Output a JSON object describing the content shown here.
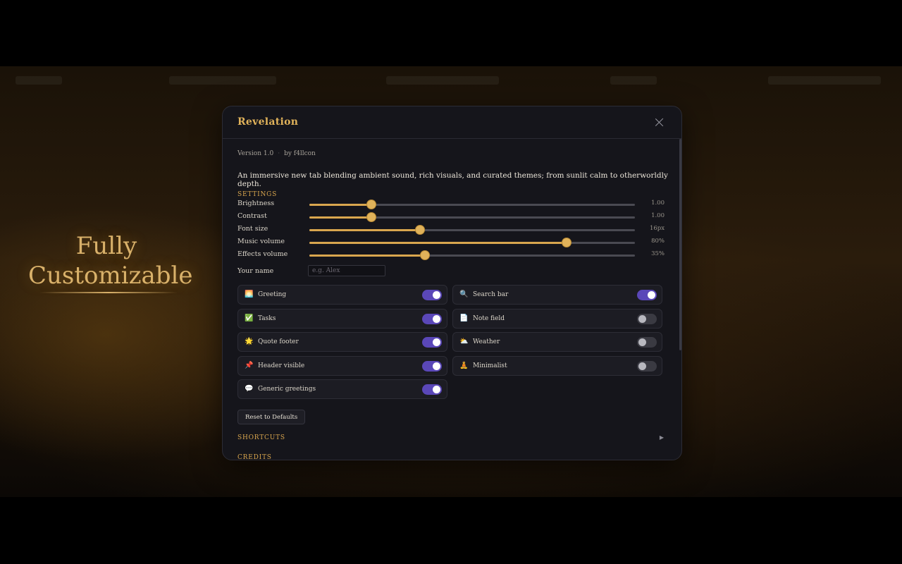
{
  "hero": {
    "line1": "Fully",
    "line2": "Customizable"
  },
  "modal": {
    "title": "Revelation",
    "version": "Version 1.0",
    "author": "by f4llcon",
    "description": "An immersive new tab blending ambient sound, rich visuals, and curated themes; from sunlit calm to otherworldly depth."
  },
  "settings": {
    "label": "SETTINGS",
    "sliders": [
      {
        "label": "Brightness",
        "value_text": "1.00",
        "fraction": 0.19
      },
      {
        "label": "Contrast",
        "value_text": "1.00",
        "fraction": 0.19
      },
      {
        "label": "Font size",
        "value_text": "16px",
        "fraction": 0.34
      },
      {
        "label": "Music volume",
        "value_text": "80%",
        "fraction": 0.79
      },
      {
        "label": "Effects volume",
        "value_text": "35%",
        "fraction": 0.355
      }
    ],
    "name_label": "Your name",
    "name_placeholder": "e.g. Alex",
    "name_value": ""
  },
  "toggles": [
    {
      "label": "Greeting",
      "icon": "🌅",
      "icon_name": "sunrise-icon",
      "on": true
    },
    {
      "label": "Search bar",
      "icon": "🔍",
      "icon_name": "search-icon",
      "on": true
    },
    {
      "label": "Tasks",
      "icon": "✅",
      "icon_name": "checkbox-icon",
      "on": true
    },
    {
      "label": "Note field",
      "icon": "📄",
      "icon_name": "note-icon",
      "on": false
    },
    {
      "label": "Quote footer",
      "icon": "🌟",
      "icon_name": "star-icon",
      "on": true
    },
    {
      "label": "Weather",
      "icon": "⛅",
      "icon_name": "weather-icon",
      "on": false
    },
    {
      "label": "Header visible",
      "icon": "📌",
      "icon_name": "pin-icon",
      "on": true
    },
    {
      "label": "Minimalist",
      "icon": "🧘",
      "icon_name": "meditation-icon",
      "on": false
    },
    {
      "label": "Generic greetings",
      "icon": "💬",
      "icon_name": "speech-bubble-icon",
      "on": true
    }
  ],
  "reset_label": "Reset to Defaults",
  "shortcuts_label": "SHORTCUTS",
  "shortcuts_chevron": "▶",
  "credits_label": "CREDITS",
  "colors": {
    "accent": "#e0b25a",
    "toggle_on": "#5a47b8",
    "panel_bg": "#15151b"
  }
}
